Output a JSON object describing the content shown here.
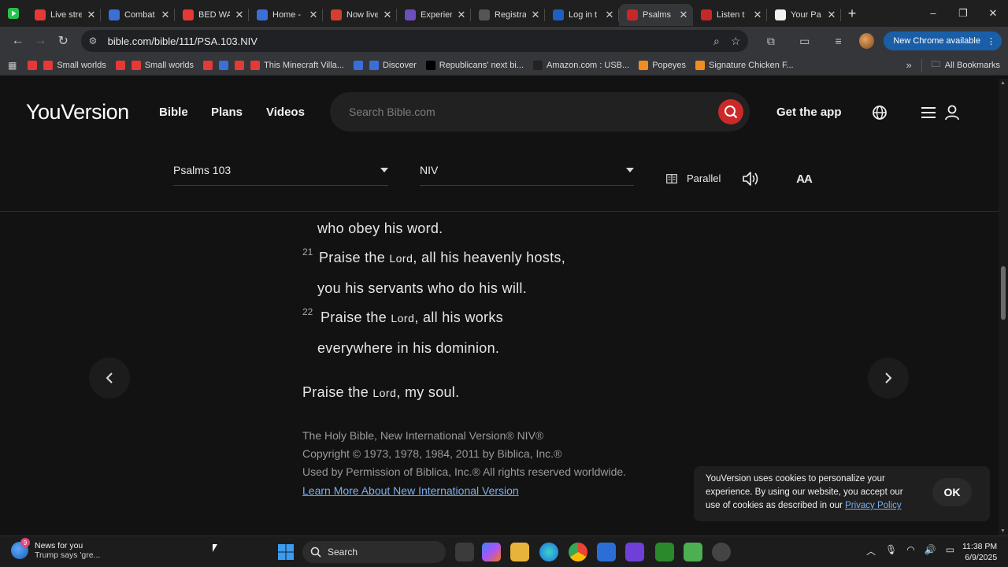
{
  "browser": {
    "tabs": [
      {
        "label": "Live stre",
        "favicon": "youtube-live-icon",
        "color": "#e53935"
      },
      {
        "label": "Combat",
        "favicon": "roblox-icon",
        "color": "#3a6fd8"
      },
      {
        "label": "BED WA",
        "favicon": "youtube-icon",
        "color": "#e53935"
      },
      {
        "label": "Home -",
        "favicon": "roblox-icon",
        "color": "#3a6fd8"
      },
      {
        "label": "Now live",
        "favicon": "gmail-icon",
        "color": "#d33f2f"
      },
      {
        "label": "Experien",
        "favicon": "globe-icon",
        "color": "#6b4fbb"
      },
      {
        "label": "Registra",
        "favicon": "globe-icon",
        "color": "#555555"
      },
      {
        "label": "Log in t",
        "favicon": "paypal-icon",
        "color": "#1f5fbf"
      },
      {
        "label": "Psalms",
        "favicon": "bible-icon",
        "color": "#c62828",
        "active": true
      },
      {
        "label": "Listen t",
        "favicon": "bible-icon",
        "color": "#c62828"
      },
      {
        "label": "Your Pa",
        "favicon": "amazon-icon",
        "color": "#f2f2f2"
      }
    ],
    "url": "bible.com/bible/111/PSA.103.NIV",
    "update_label": "New Chrome available",
    "bookmarks": [
      {
        "label": "",
        "color": "#e53935"
      },
      {
        "label": "Small worlds",
        "color": "#e53935"
      },
      {
        "label": "",
        "color": "#e53935"
      },
      {
        "label": "Small worlds",
        "color": "#e53935"
      },
      {
        "label": "",
        "color": "#e53935"
      },
      {
        "label": "",
        "color": "#3a6fd8"
      },
      {
        "label": "",
        "color": "#e53935"
      },
      {
        "label": "This Minecraft Villa...",
        "color": "#e53935"
      },
      {
        "label": "",
        "color": "#3a6fd8"
      },
      {
        "label": "Discover",
        "color": "#3a6fd8"
      },
      {
        "label": "Republicans' next bi...",
        "color": "#000000"
      },
      {
        "label": "Amazon.com : USB...",
        "color": "#222222"
      },
      {
        "label": "Popeyes",
        "color": "#f28c1d"
      },
      {
        "label": "Signature Chicken F...",
        "color": "#f28c1d"
      }
    ],
    "all_bookmarks": "All Bookmarks"
  },
  "site": {
    "logo": "YouVersion",
    "nav": [
      "Bible",
      "Plans",
      "Videos"
    ],
    "search_placeholder": "Search Bible.com",
    "get_app": "Get the app",
    "book_selector": "Psalms 103",
    "version_selector": "NIV",
    "parallel": "Parallel",
    "aa": "AA"
  },
  "passage": {
    "l1": "who obey his word.",
    "v21": "21",
    "l2_pre": "Praise the ",
    "l2_lord": "Lord",
    "l2_post": ", all his heavenly hosts,",
    "l3": "you his servants who do his will.",
    "v22": "22",
    "l4_pre": "Praise the ",
    "l4_lord": "Lord",
    "l4_post": ", all his works",
    "l5": "everywhere in his dominion.",
    "l6_pre": "Praise the ",
    "l6_lord": "Lord",
    "l6_post": ", my soul."
  },
  "copyright": {
    "line1": "The Holy Bible, New International Version® NIV®",
    "line2": "Copyright © 1973, 1978, 1984, 2011 by Biblica, Inc.®",
    "line3": "Used by Permission of Biblica, Inc.® All rights reserved worldwide.",
    "learn_more": "Learn More About New International Version"
  },
  "cookie": {
    "text": "YouVersion uses cookies to personalize your experience. By using our website, you accept our use of cookies as described in our",
    "link": "Privacy Policy",
    "ok": "OK"
  },
  "taskbar": {
    "news_title": "News for you",
    "news_sub": "Trump says 'gre...",
    "news_badge": "9",
    "search": "Search",
    "time": "11:38 PM",
    "date": "6/9/2025"
  }
}
